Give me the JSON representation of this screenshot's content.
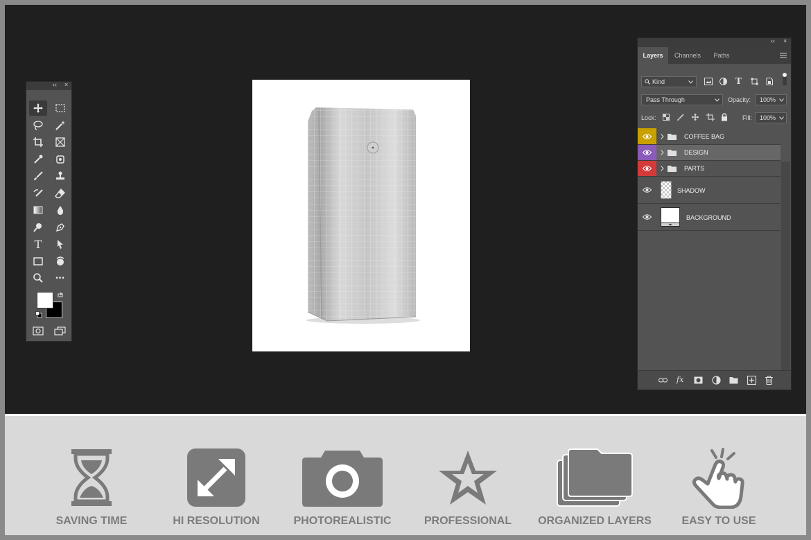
{
  "tools_panel": {
    "collapse_glyph": "‹‹",
    "close_glyph": "×",
    "tools": [
      "move-tool-icon",
      "marquee-tool-icon",
      "lasso-tool-icon",
      "magic-wand-tool-icon",
      "crop-tool-icon",
      "frame-tool-icon",
      "eyedropper-tool-icon",
      "patch-tool-icon",
      "brush-tool-icon",
      "stamp-tool-icon",
      "history-brush-tool-icon",
      "eraser-tool-icon",
      "gradient-tool-icon",
      "blur-tool-icon",
      "dodge-tool-icon",
      "pen-tool-icon",
      "type-tool-icon",
      "path-selection-tool-icon",
      "rectangle-tool-icon",
      "rotate-view-tool-icon",
      "zoom-tool-icon",
      "more-tools-icon"
    ],
    "type_glyph": "T",
    "more_glyph": "•••"
  },
  "layers_panel": {
    "collapse_glyph": "‹‹",
    "close_glyph": "×",
    "tabs": [
      "Layers",
      "Channels",
      "Paths"
    ],
    "filter_kind": "Kind",
    "filter_type_glyph": "T",
    "blend_mode": "Pass Through",
    "opacity_label": "Opacity:",
    "opacity_value": "100%",
    "lock_label": "Lock:",
    "fill_label": "Fill:",
    "fill_value": "100%",
    "fx_glyph": "fx",
    "layers": [
      {
        "name": "COFFEE BAG",
        "type": "group",
        "color": "#c8a000"
      },
      {
        "name": "DESIGN",
        "type": "group",
        "color": "#8a5bb8"
      },
      {
        "name": "PARTS",
        "type": "group",
        "color": "#d33a3a"
      },
      {
        "name": "SHADOW",
        "type": "layer",
        "color": ""
      },
      {
        "name": "BACKGROUND",
        "type": "layer",
        "color": ""
      }
    ]
  },
  "features": [
    {
      "label": "SAVING TIME",
      "icon": "hourglass-icon"
    },
    {
      "label": "HI RESOLUTION",
      "icon": "expand-arrows-icon"
    },
    {
      "label": "PHOTOREALISTIC",
      "icon": "camera-icon"
    },
    {
      "label": "PROFESSIONAL",
      "icon": "star-icon"
    },
    {
      "label": "ORGANIZED LAYERS",
      "icon": "stacked-folders-icon"
    },
    {
      "label": "EASY TO USE",
      "icon": "tap-hand-icon"
    }
  ],
  "colors": {
    "workspace": "#1f1f1f",
    "panel": "#535353",
    "feature_band": "#d9d9d9",
    "feature_icon": "#7a7a7a"
  }
}
